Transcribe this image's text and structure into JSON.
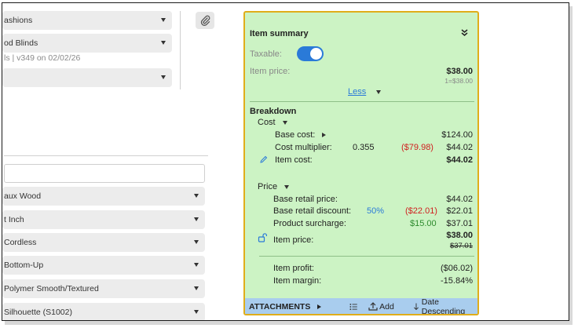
{
  "form": {
    "collection": "ashions",
    "product": "od Blinds",
    "meta": "ls | v349 on 02/02/26",
    "fields": [
      "aux Wood",
      "t Inch",
      "Cordless",
      "Bottom-Up",
      "Polymer Smooth/Textured",
      "Silhouette (S1002)"
    ]
  },
  "summary": {
    "title": "Item summary",
    "taxable_label": "Taxable:",
    "taxable_on": true,
    "item_price_label": "Item price:",
    "item_price": "$38.00",
    "item_price_sub": "1=$38.00",
    "less_link": "Less"
  },
  "breakdown": {
    "title": "Breakdown",
    "cost": {
      "label": "Cost",
      "base_cost_label": "Base cost:",
      "base_cost": "$124.00",
      "multiplier_label": "Cost multiplier:",
      "multiplier_value": "0.355",
      "multiplier_diff": "($79.98)",
      "multiplier_total": "$44.02",
      "item_cost_label": "Item cost:",
      "item_cost": "$44.02"
    },
    "price": {
      "label": "Price",
      "base_retail_label": "Base retail price:",
      "base_retail": "$44.02",
      "discount_label": "Base retail discount:",
      "discount_pct": "50%",
      "discount_diff": "($22.01)",
      "discount_total": "$22.01",
      "surcharge_label": "Product surcharge:",
      "surcharge_diff": "$15.00",
      "surcharge_total": "$37.01",
      "item_price_label": "Item price:",
      "item_price": "$38.00",
      "item_price_old": "$37.01"
    },
    "profit_label": "Item profit:",
    "profit": "($06.02)",
    "margin_label": "Item margin:",
    "margin": "-15.84%"
  },
  "attachments": {
    "title": "ATTACHMENTS",
    "add_label": "Add",
    "sort_label": "Date Descending"
  },
  "colors": {
    "panel_bg": "#ccf3c4",
    "panel_border": "#e0ad1a",
    "accent": "#2a7ad8",
    "negative": "#d02020",
    "positive": "#2e8b2e"
  }
}
